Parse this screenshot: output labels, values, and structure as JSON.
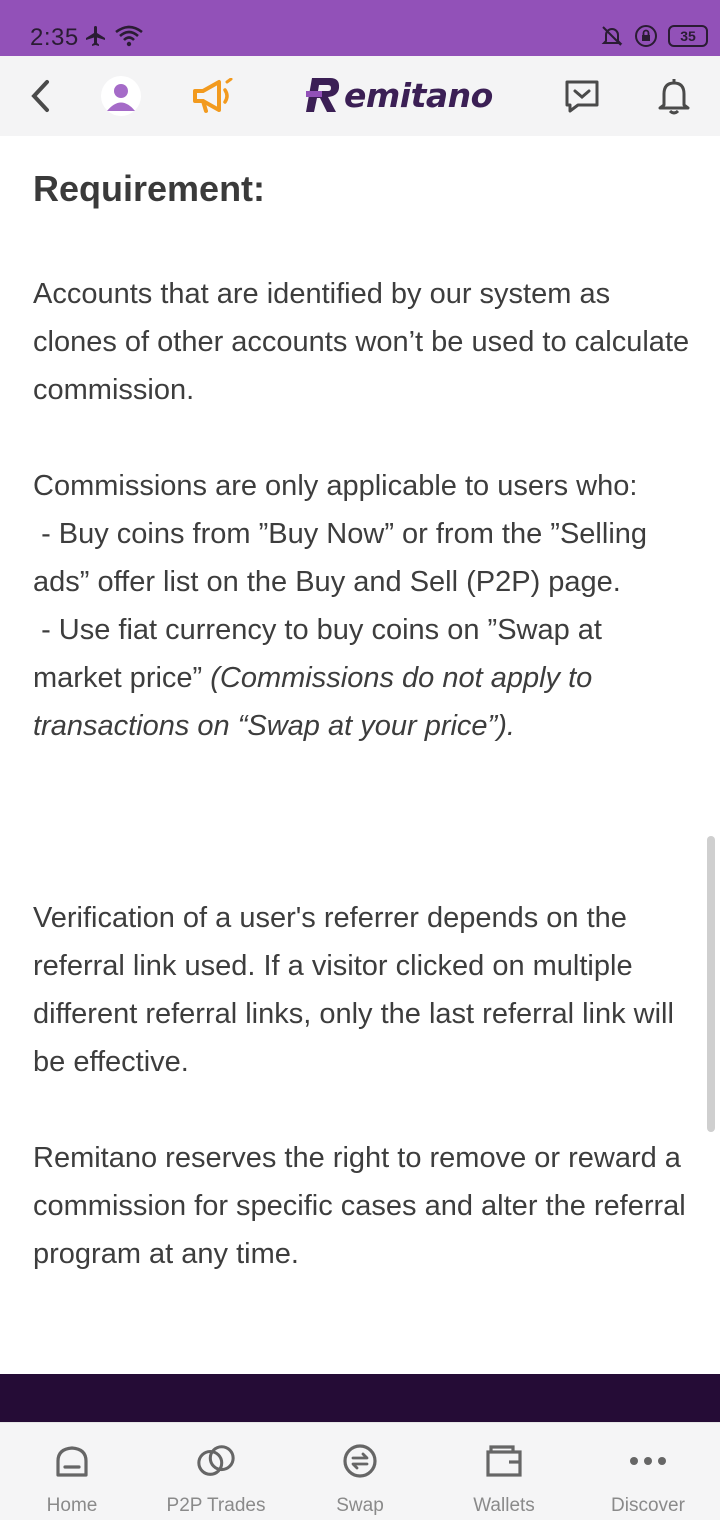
{
  "status_bar": {
    "time": "2:35",
    "battery": "35"
  },
  "header": {
    "brand": "emitano",
    "brand_color": "#3b1f55",
    "accent_color": "#9251b8"
  },
  "content": {
    "heading": "Requirement:",
    "p1": "Accounts that are identified by our system as clones of other accounts won’t be used to calculate commission.",
    "p2_line1": "Commissions are only applicable to users who:",
    "p2_line2": " - Buy coins from ”Buy Now” or from the ”Selling ads” offer list on the Buy and Sell (P2P) page.",
    "p2_line3_normal": " - Use fiat currency to buy coins on ”Swap at market price”",
    "p2_line3_italic": " (Commissions do not apply to transactions on “Swap at your price”).",
    "p3": "Verification of a user's referrer depends on the referral link used. If a visitor clicked on multiple different referral links, only the last referral link will be effective.",
    "p4": "Remitano reserves the right to remove or reward a commission for specific cases and alter the referral program at any time."
  },
  "bottom_nav": {
    "items": [
      {
        "label": "Home",
        "icon": "home-icon"
      },
      {
        "label": "P2P Trades",
        "icon": "p2p-trades-icon"
      },
      {
        "label": "Swap",
        "icon": "swap-icon"
      },
      {
        "label": "Wallets",
        "icon": "wallet-icon"
      },
      {
        "label": "Discover",
        "icon": "more-dots-icon"
      }
    ]
  }
}
